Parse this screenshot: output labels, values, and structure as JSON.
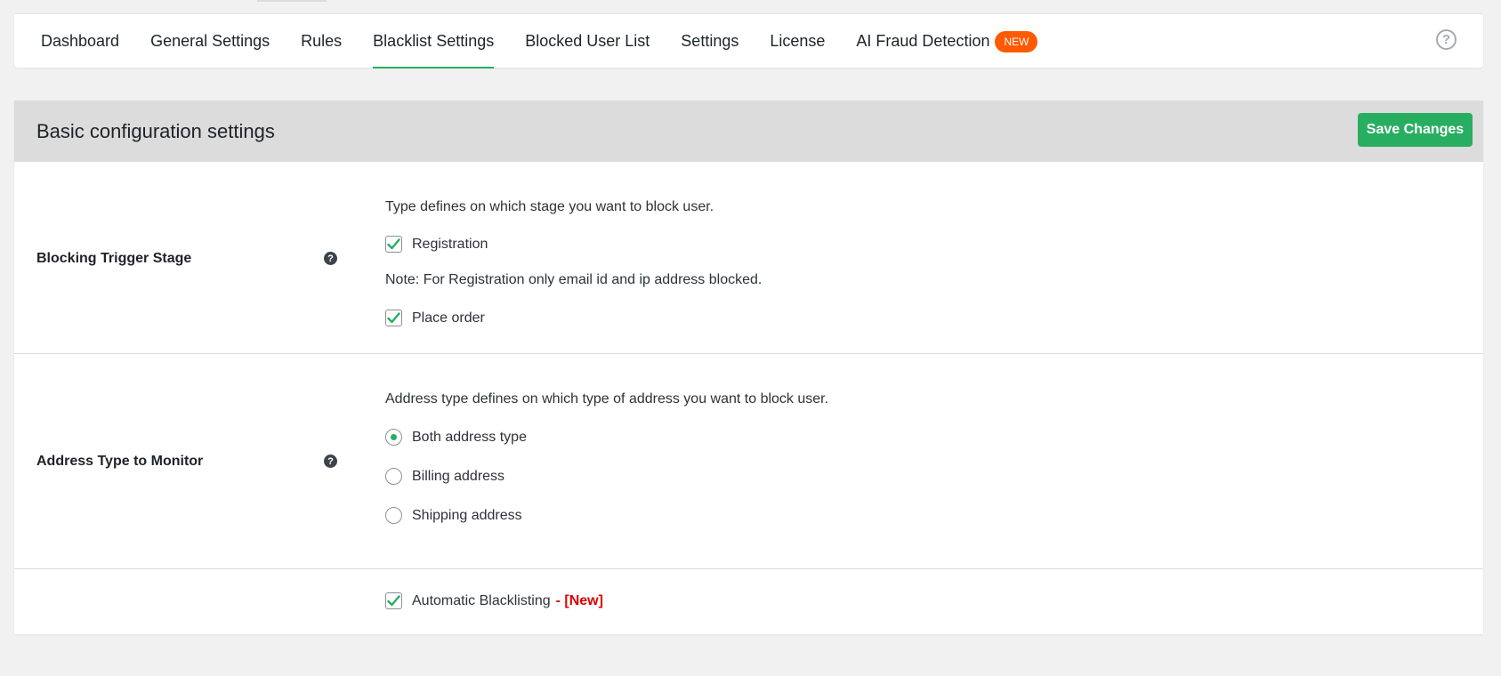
{
  "nav": {
    "tabs": [
      {
        "label": "Dashboard"
      },
      {
        "label": "General Settings"
      },
      {
        "label": "Rules"
      },
      {
        "label": "Blacklist Settings",
        "active": true
      },
      {
        "label": "Blocked User List"
      },
      {
        "label": "Settings"
      },
      {
        "label": "License"
      },
      {
        "label": "AI Fraud Detection",
        "badge": "NEW"
      }
    ],
    "help_icon": "?"
  },
  "panel": {
    "title": "Basic configuration settings",
    "save_label": "Save Changes"
  },
  "blocking_stage": {
    "label": "Blocking Trigger Stage",
    "help": "?",
    "description": "Type defines on which stage you want to block user.",
    "registration_label": "Registration",
    "registration_checked": true,
    "note": "Note: For Registration only email id and ip address blocked.",
    "place_order_label": "Place order",
    "place_order_checked": true
  },
  "address_type": {
    "label": "Address Type to Monitor",
    "help": "?",
    "description": "Address type defines on which type of address you want to block user.",
    "options": [
      {
        "label": "Both address type",
        "selected": true
      },
      {
        "label": "Billing address",
        "selected": false
      },
      {
        "label": "Shipping address",
        "selected": false
      }
    ]
  },
  "auto_blacklist": {
    "label": "Automatic Blacklisting",
    "checked": true,
    "new_tag": "- [New]"
  },
  "colors": {
    "accent": "#27ae60",
    "badge": "#ff5a00",
    "new_tag": "#e00000"
  }
}
